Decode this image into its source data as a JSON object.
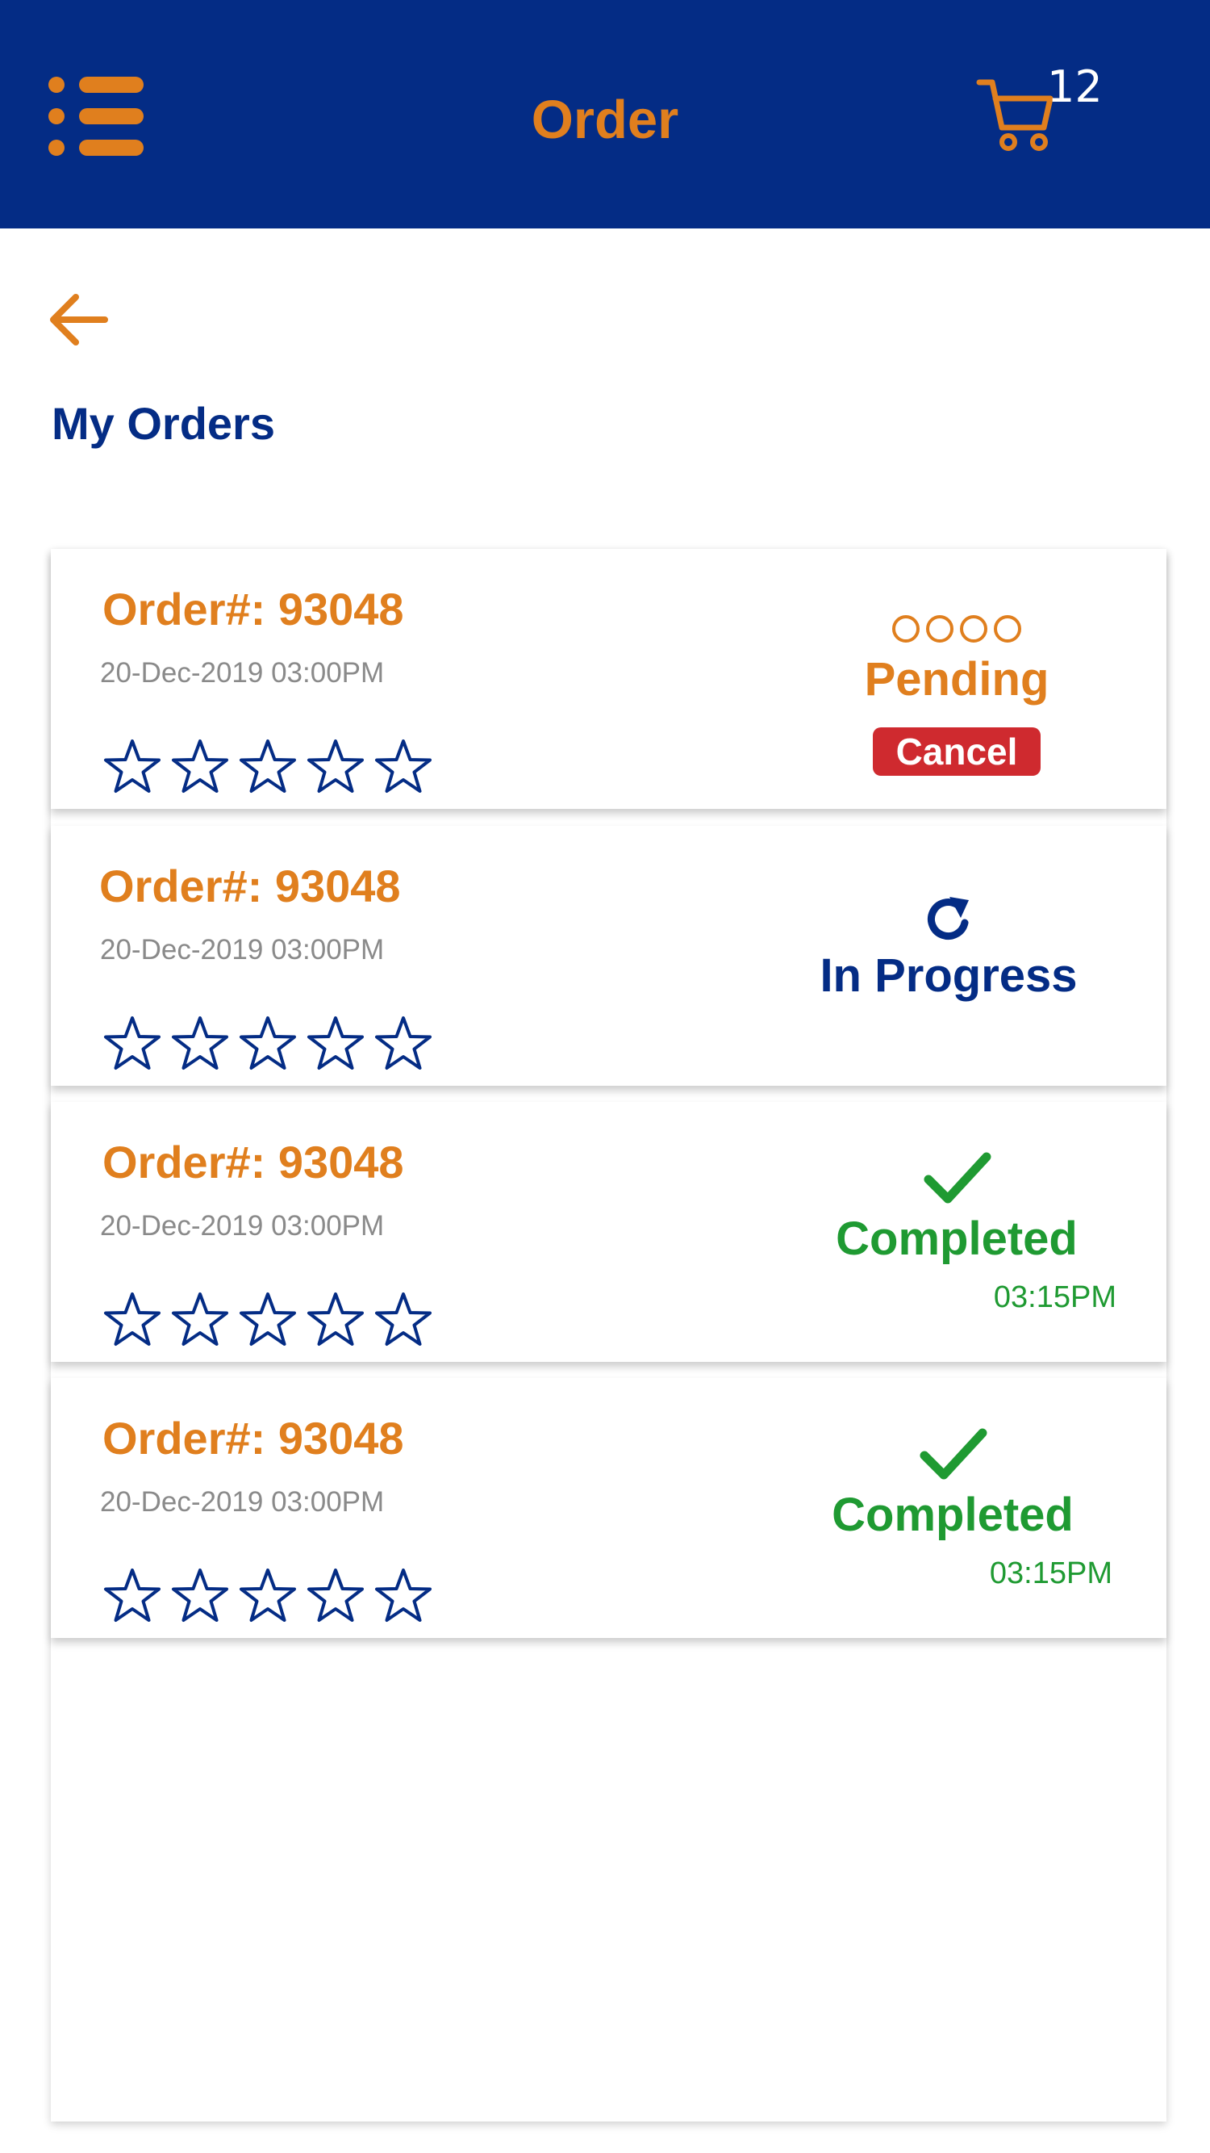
{
  "header": {
    "title": "Order",
    "cart_count": "12",
    "menu_icon": "menu-list-icon",
    "cart_icon": "shopping-cart-icon"
  },
  "subheader": {
    "back_icon": "back-arrow-icon",
    "section_title": "My Orders"
  },
  "colors": {
    "brand_blue": "#042c85",
    "accent_orange": "#e07f1e",
    "success_green": "#1f9a32",
    "danger_red": "#cf2a2f",
    "muted_gray": "#8a8a8a"
  },
  "orders": [
    {
      "order_no": "Order#: 93048",
      "date": "20-Dec-2019 03:00PM",
      "rating": 0,
      "status": "Pending",
      "status_icon": "pending-dots-icon",
      "action": "Cancel"
    },
    {
      "order_no": "Order#: 93048",
      "date": "20-Dec-2019 03:00PM",
      "rating": 0,
      "status": "In Progress",
      "status_icon": "refresh-icon"
    },
    {
      "order_no": "Order#: 93048",
      "date": "20-Dec-2019 03:00PM",
      "rating": 0,
      "status": "Completed",
      "status_icon": "checkmark-icon",
      "time": "03:15PM"
    },
    {
      "order_no": "Order#: 93048",
      "date": "20-Dec-2019 03:00PM",
      "rating": 0,
      "status": "Completed",
      "status_icon": "checkmark-icon",
      "time": "03:15PM"
    }
  ]
}
